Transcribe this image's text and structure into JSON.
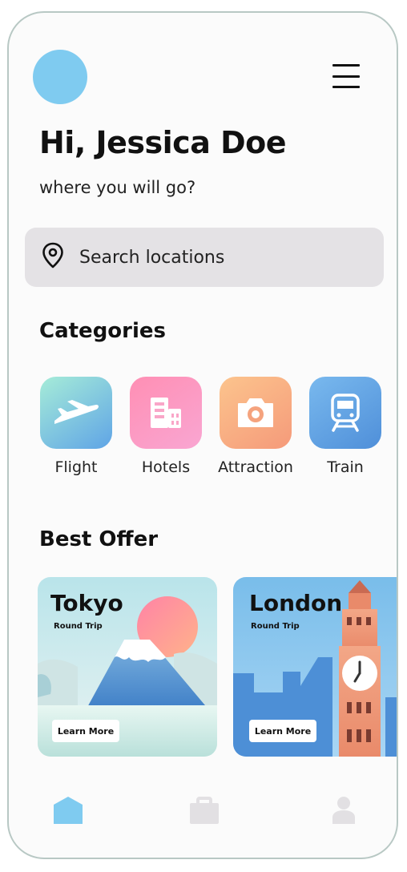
{
  "header": {
    "greeting": "Hi, Jessica Doe",
    "subtitle": "where you will go?"
  },
  "search": {
    "placeholder": "Search locations",
    "icon": "location-pin-icon"
  },
  "categories": {
    "title": "Categories",
    "items": [
      {
        "label": "Flight",
        "icon": "airplane-icon"
      },
      {
        "label": "Hotels",
        "icon": "building-icon"
      },
      {
        "label": "Attraction",
        "icon": "camera-icon"
      },
      {
        "label": "Train",
        "icon": "train-icon"
      }
    ]
  },
  "best_offer": {
    "title": "Best Offer",
    "offers": [
      {
        "city": "Tokyo",
        "trip": "Round Trip",
        "button": "Learn More"
      },
      {
        "city": "London",
        "trip": "Round Trip",
        "button": "Learn More"
      }
    ]
  },
  "bottom_nav": {
    "items": [
      {
        "icon": "home-icon",
        "active": true,
        "color": "#7fcbf0"
      },
      {
        "icon": "briefcase-icon",
        "active": false,
        "color": "#e2e0e3"
      },
      {
        "icon": "profile-icon",
        "active": false,
        "color": "#e2e0e3"
      }
    ]
  },
  "colors": {
    "accent": "#7fcbf0",
    "search_bg": "#e4e2e5"
  }
}
